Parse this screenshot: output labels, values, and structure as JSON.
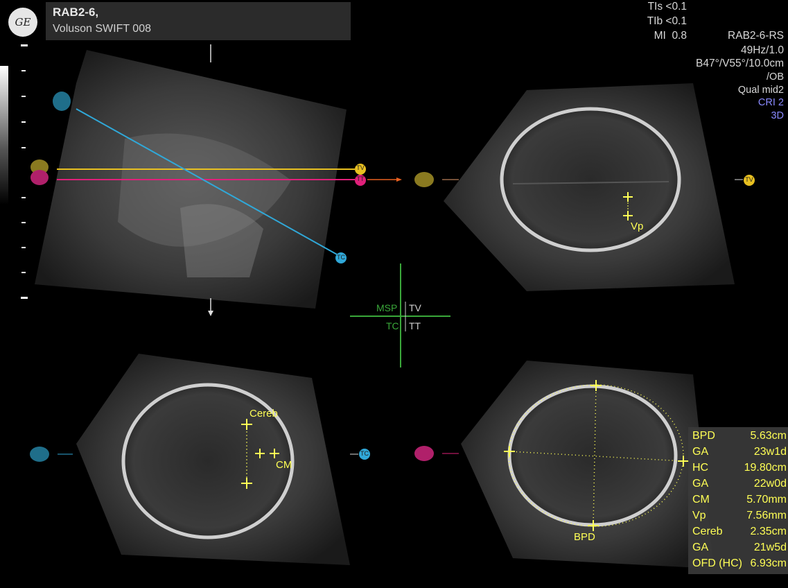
{
  "header": {
    "probe": "RAB2-6,",
    "system": "Voluson SWIFT 008",
    "logo_text": "GE"
  },
  "acoustic": {
    "tis": "TIs <0.1",
    "tib": "TIb <0.1",
    "mi": "MI  0.8"
  },
  "settings": {
    "probe_mode": "RAB2-6-RS",
    "frequency": "49Hz/1.0",
    "angle_depth": "B47°/V55°/10.0cm",
    "application": "/OB",
    "quality": "Qual mid2",
    "cri": "CRI 2",
    "mode": "3D"
  },
  "planes": {
    "tv": "TV",
    "tt": "TT",
    "tc": "TC",
    "msp": "MSP"
  },
  "orientation": {
    "top_left": "MSP",
    "top_right": "TV",
    "bottom_left": "TC",
    "bottom_right": "TT"
  },
  "labels": {
    "vp": "Vp",
    "cereb": "Cereb",
    "cm": "CM",
    "bpd": "BPD"
  },
  "measurements": [
    {
      "name": "BPD",
      "value": "5.63cm"
    },
    {
      "name": "GA",
      "value": "23w1d"
    },
    {
      "name": "HC",
      "value": "19.80cm"
    },
    {
      "name": "GA",
      "value": "22w0d"
    },
    {
      "name": "CM",
      "value": "5.70mm"
    },
    {
      "name": "Vp",
      "value": "7.56mm"
    },
    {
      "name": "Cereb",
      "value": "2.35cm"
    },
    {
      "name": "GA",
      "value": "21w5d"
    },
    {
      "name": "OFD (HC)",
      "value": "6.93cm"
    }
  ],
  "colors": {
    "tv_line": "#e8c020",
    "tt_line": "#e0207a",
    "tc_line": "#30a8d8",
    "caliper": "#ffff55",
    "cri": "#8a8aff",
    "orientation": "#3aa83a"
  }
}
